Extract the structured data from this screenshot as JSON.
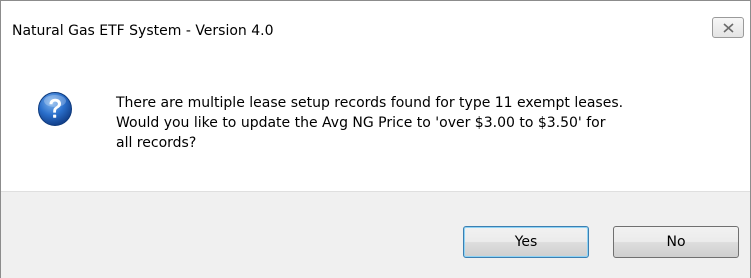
{
  "window": {
    "title": "Natural Gas ETF System - Version 4.0",
    "close_icon": "close-icon"
  },
  "message": {
    "icon": "question-icon",
    "lines": [
      "There are multiple lease setup records found for type 11 exempt leases.",
      "Would you like to update the Avg NG Price to 'over $3.00 to $3.50' for",
      "all records?"
    ]
  },
  "buttons": {
    "yes_label": "Yes",
    "no_label": "No"
  },
  "colors": {
    "icon_blue": "#1f5fb5",
    "default_button_border": "#3c7fb1",
    "footer_background": "#f0f0f0"
  }
}
